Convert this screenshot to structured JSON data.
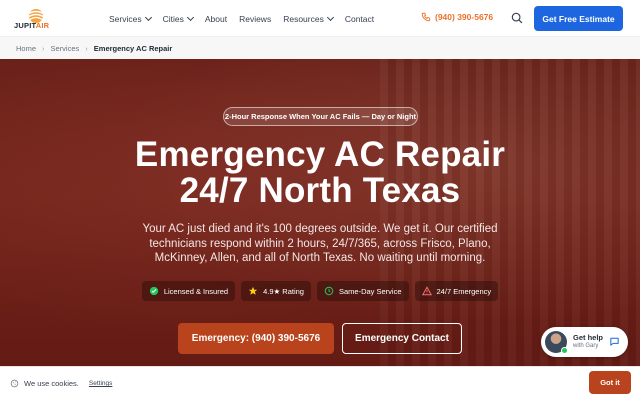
{
  "header": {
    "logo_text_a": "JUPIT",
    "logo_text_b": "AIR",
    "nav": [
      {
        "label": "Services",
        "dropdown": true
      },
      {
        "label": "Cities",
        "dropdown": true
      },
      {
        "label": "About",
        "dropdown": false
      },
      {
        "label": "Reviews",
        "dropdown": false
      },
      {
        "label": "Resources",
        "dropdown": true
      },
      {
        "label": "Contact",
        "dropdown": false
      }
    ],
    "phone": "(940) 390-5676",
    "cta_label": "Get Free Estimate"
  },
  "breadcrumb": {
    "items": [
      "Home",
      "Services"
    ],
    "current": "Emergency AC Repair"
  },
  "hero": {
    "pill": "2-Hour Response When Your AC Fails — Day or Night",
    "title_line1": "Emergency AC Repair",
    "title_line2": "24/7 North Texas",
    "lead": "Your AC just died and it's 100 degrees outside. We get it. Our certified technicians respond within 2 hours, 24/7/365, across Frisco, Plano, McKinney, Allen, and all of North Texas. No waiting until morning.",
    "badges": [
      {
        "icon": "check-shield-icon",
        "label": "Licensed & Insured"
      },
      {
        "icon": "star-icon",
        "label": "4.9★ Rating"
      },
      {
        "icon": "clock-icon",
        "label": "Same-Day Service"
      },
      {
        "icon": "warning-icon",
        "label": "24/7 Emergency"
      }
    ],
    "primary_button": "Emergency: (940) 390-5676",
    "secondary_button": "Emergency Contact"
  },
  "chat": {
    "title": "Get help",
    "subtitle": "with Gary"
  },
  "cookie": {
    "message": "We use cookies.",
    "settings_label": "Settings",
    "accept_label": "Got it"
  },
  "colors": {
    "brand_orange": "#e8742a",
    "cta_blue": "#1d66e0",
    "hero_red": "#7e2a1f",
    "button_rust": "#b8431d"
  }
}
